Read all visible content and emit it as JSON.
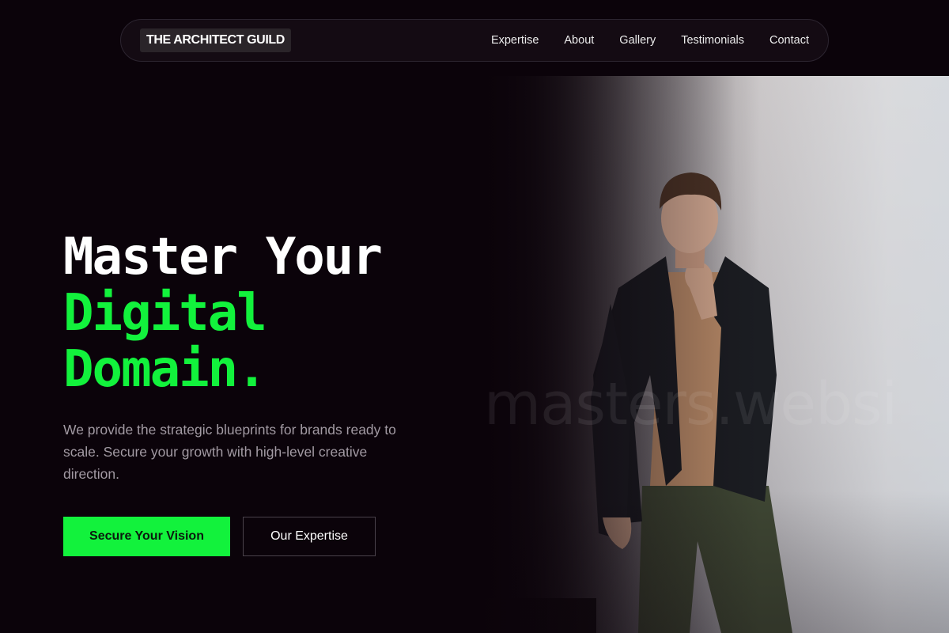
{
  "nav": {
    "brand": "THE ARCHITECT GUILD",
    "links": [
      "Expertise",
      "About",
      "Gallery",
      "Testimonials",
      "Contact"
    ]
  },
  "hero": {
    "headline": {
      "line1": "Master Your",
      "line2": "Digital",
      "line3": "Domain."
    },
    "subtext": "We provide the strategic blueprints for brands ready to scale. Secure your growth with high-level creative direction.",
    "primary_cta": "Secure Your Vision",
    "secondary_cta": "Our Expertise",
    "watermark": "masters.websi"
  },
  "colors": {
    "background": "#0b030a",
    "accent": "#12f23c",
    "muted_text": "#a29aa3"
  }
}
